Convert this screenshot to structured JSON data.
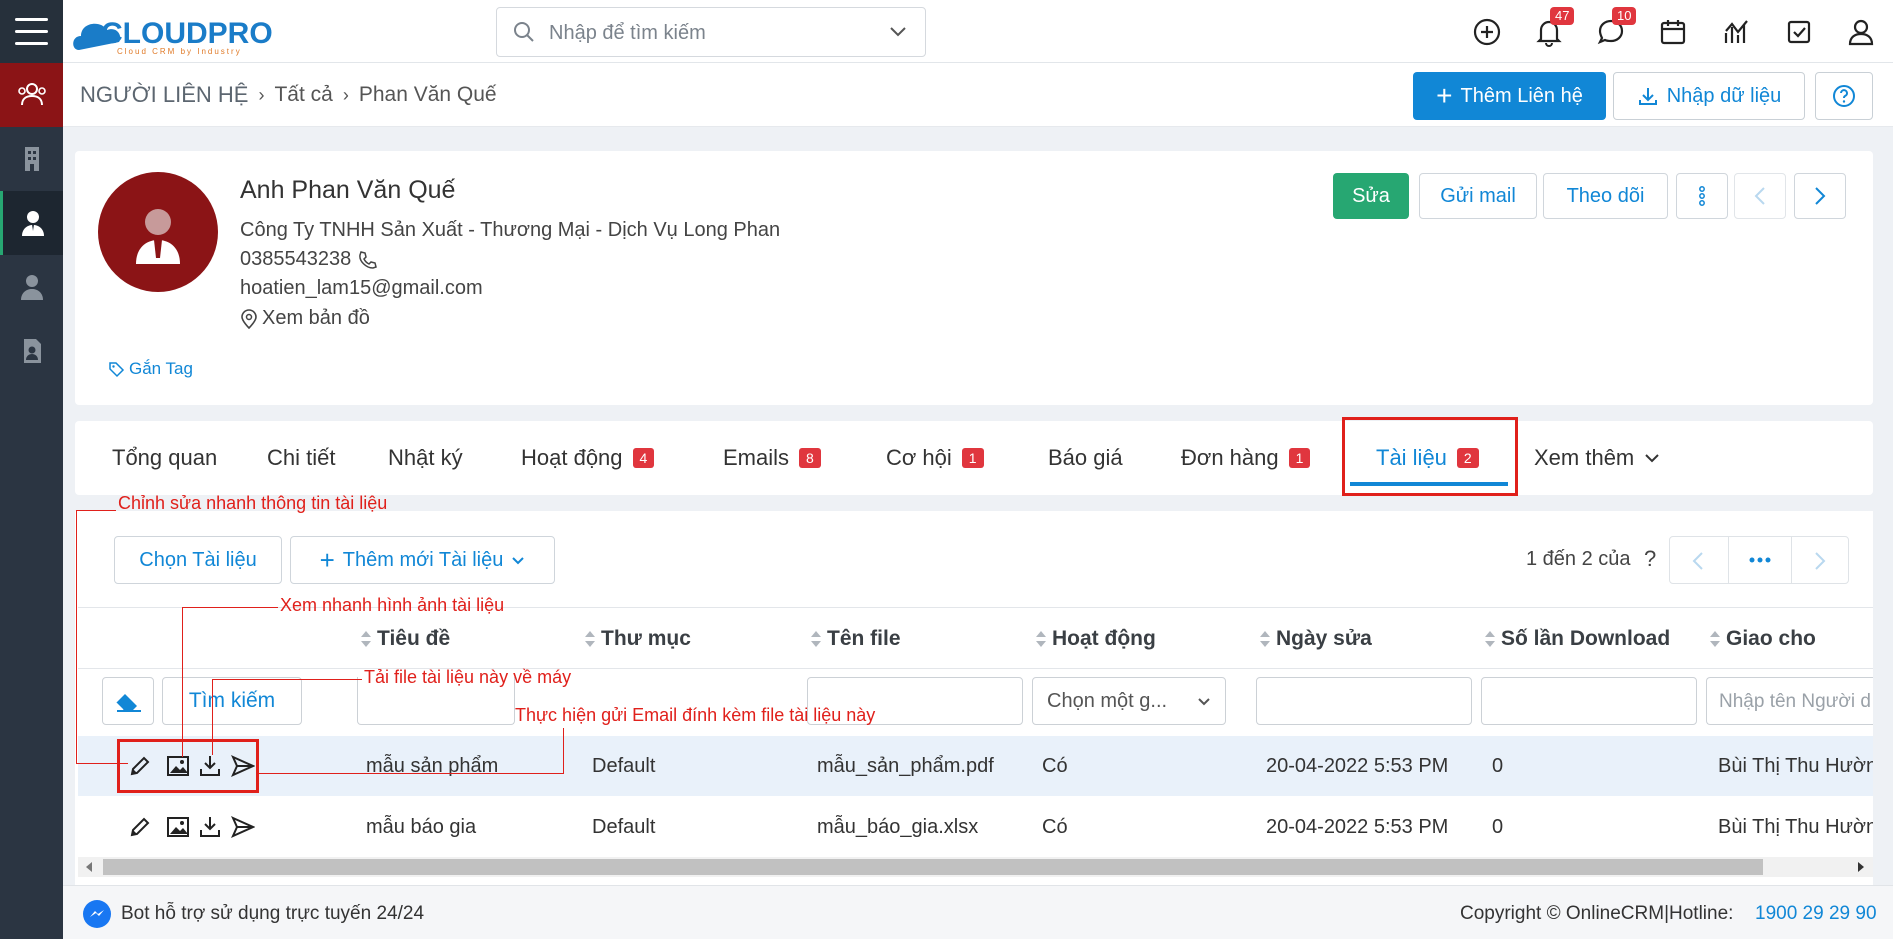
{
  "app": {
    "logo_text": "CLOUDPRO",
    "logo_tagline": "Cloud CRM by Industry",
    "search_placeholder": "Nhập để tìm kiếm",
    "notifications_count": "47",
    "messages_count": "10"
  },
  "header": {
    "breadcrumb_root": "NGƯỜI LIÊN HỆ",
    "breadcrumb_all": "Tất cả",
    "breadcrumb_current": "Phan Văn Quế",
    "add_contact": "Thêm Liên hệ",
    "import_data": "Nhập dữ liệu"
  },
  "contact": {
    "name": "Anh Phan Văn Quế",
    "company": "Công Ty TNHH Sản Xuất - Thương Mại - Dịch Vụ Long Phan",
    "phone": "0385543238",
    "email": "hoatien_lam15@gmail.com",
    "map": "Xem bản đồ",
    "tag": "Gắn Tag",
    "edit": "Sửa",
    "send_mail": "Gửi mail",
    "follow": "Theo dõi"
  },
  "tabs": [
    {
      "label": "Tổng quan",
      "count": ""
    },
    {
      "label": "Chi tiết",
      "count": ""
    },
    {
      "label": "Nhật ký",
      "count": ""
    },
    {
      "label": "Hoạt động",
      "count": "4"
    },
    {
      "label": "Emails",
      "count": "8"
    },
    {
      "label": "Cơ hội",
      "count": "1"
    },
    {
      "label": "Báo giá",
      "count": ""
    },
    {
      "label": "Đơn hàng",
      "count": "1"
    },
    {
      "label": "Tài liệu",
      "count": "2"
    },
    {
      "label": "Xem thêm",
      "count": ""
    }
  ],
  "docs": {
    "select_doc": "Chọn Tài liệu",
    "add_doc": "Thêm mới Tài liệu",
    "pager": "1 đến 2 của",
    "pager_q": "?",
    "search_btn": "Tìm kiếm",
    "select_one": "Chọn một g...",
    "assignee_placeholder": "Nhập tên Người d",
    "columns": [
      "Tiêu đề",
      "Thư mục",
      "Tên file",
      "Hoạt động",
      "Ngày sửa",
      "Số lần Download",
      "Giao cho"
    ],
    "rows": [
      [
        "mẫu sản phẩm",
        "Default",
        "mẫu_sản_phẩm.pdf",
        "Có",
        "20-04-2022 5:53 PM",
        "0",
        "Bùi Thị Thu Hườn"
      ],
      [
        "mẫu báo gia",
        "Default",
        "mẫu_báo_gia.xlsx",
        "Có",
        "20-04-2022 5:53 PM",
        "0",
        "Bùi Thị Thu Hườn"
      ]
    ]
  },
  "annotations": {
    "edit_note": "Chỉnh sửa nhanh thông tin tài liệu",
    "view_note": "Xem nhanh hình ảnh tài liệu",
    "download_note": "Tải file tài liệu này về máy",
    "email_note": "Thực hiện gửi Email đính kèm file tài liệu này"
  },
  "footer": {
    "bot": "Bot hỗ trợ sử dụng trực tuyến 24/24",
    "copyright": "Copyright © OnlineCRM|Hotline:",
    "hotline": "1900 29 29 90"
  },
  "colors": {
    "primary": "#1187d6",
    "success": "#27a772",
    "badge": "#e0363e",
    "annotation": "#e0201b",
    "sidebar": "#2b3542"
  }
}
